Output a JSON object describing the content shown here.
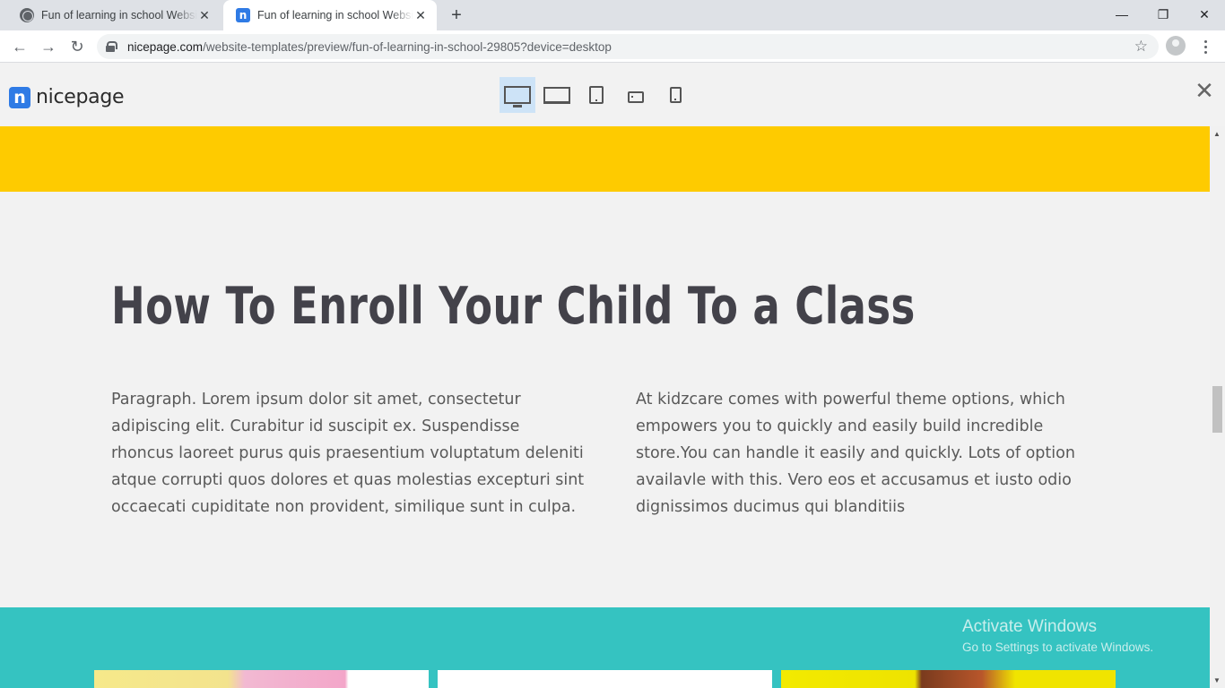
{
  "browser": {
    "tabs": [
      {
        "title": "Fun of learning in school Website Template",
        "favicon": "globe-icon",
        "active": false
      },
      {
        "title": "Fun of learning in school Website Template",
        "favicon": "nicepage-icon",
        "active": true
      }
    ],
    "new_tab_label": "+",
    "window_controls": {
      "minimize": "—",
      "restore": "❐",
      "close": "✕"
    },
    "url_host": "nicepage.com",
    "url_path": "/website-templates/preview/fun-of-learning-in-school-29805?device=desktop"
  },
  "preview_header": {
    "logo_mark": "n",
    "logo_text": "nicepage",
    "devices": [
      "desktop-icon",
      "laptop-icon",
      "tablet-icon",
      "tablet-landscape-icon",
      "phone-icon"
    ],
    "active_device": "desktop",
    "close_label": "✕"
  },
  "page": {
    "heading": "How To Enroll Your Child To a Class",
    "paragraph_left": "Paragraph. Lorem ipsum dolor sit amet, consectetur adipiscing elit. Curabitur id suscipit ex. Suspendisse rhoncus laoreet purus quis praesentium voluptatum deleniti atque corrupti quos dolores et quas molestias excepturi sint occaecati cupiditate non provident, similique sunt in culpa.",
    "paragraph_right": "At kidzcare comes with powerful theme options, which empowers you to quickly and easily build incredible store.You can handle it easily and quickly. Lots of option availavle with this. Vero eos et accusamus et iusto odio dignissimos ducimus qui blanditiis"
  },
  "watermark": {
    "line1": "Activate Windows",
    "line2": "Go to Settings to activate Windows."
  },
  "colors": {
    "yellow_band": "#fecb00",
    "teal_band": "#35c3c1",
    "heading": "#43424a",
    "accent": "#2f7be5"
  }
}
